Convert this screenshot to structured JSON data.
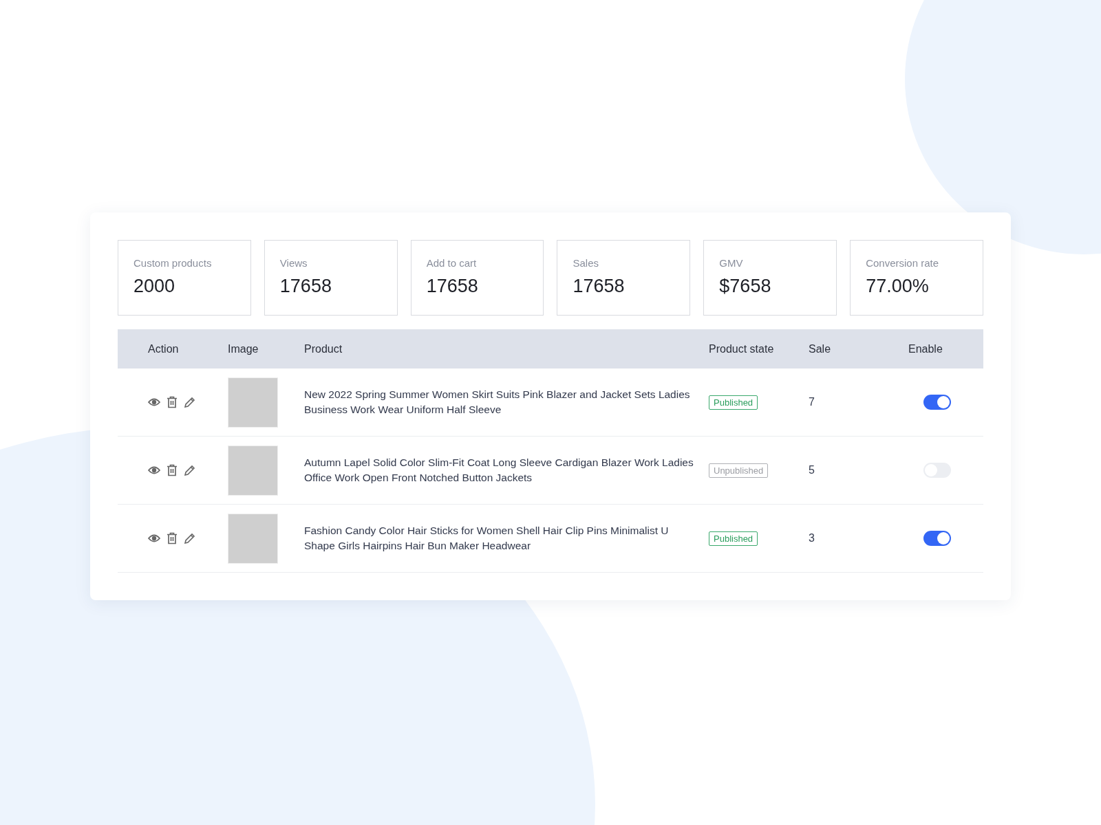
{
  "stats": [
    {
      "label": "Custom products",
      "value": "2000"
    },
    {
      "label": "Views",
      "value": "17658"
    },
    {
      "label": "Add to cart",
      "value": "17658"
    },
    {
      "label": "Sales",
      "value": "17658"
    },
    {
      "label": "GMV",
      "value": "$7658"
    },
    {
      "label": "Conversion rate",
      "value": "77.00%"
    }
  ],
  "table": {
    "columns": [
      "Action",
      "Image",
      "Product",
      "Product state",
      "Sale",
      "Enable"
    ],
    "rows": [
      {
        "product": "New 2022 Spring Summer Women Skirt Suits Pink Blazer and Jacket Sets Ladies Business Work Wear Uniform Half Sleeve",
        "state": "Published",
        "published": true,
        "sale": "7",
        "enabled": true
      },
      {
        "product": "Autumn Lapel Solid Color Slim-Fit Coat Long Sleeve Cardigan Blazer Work Ladies Office Work  Open Front Notched Button Jackets",
        "state": "Unpublished",
        "published": false,
        "sale": "5",
        "enabled": false
      },
      {
        "product": "Fashion Candy Color Hair Sticks for Women Shell Hair Clip Pins Minimalist U Shape Girls Hairpins Hair Bun Maker Headwear",
        "state": "Published",
        "published": true,
        "sale": "3",
        "enabled": true
      }
    ]
  }
}
